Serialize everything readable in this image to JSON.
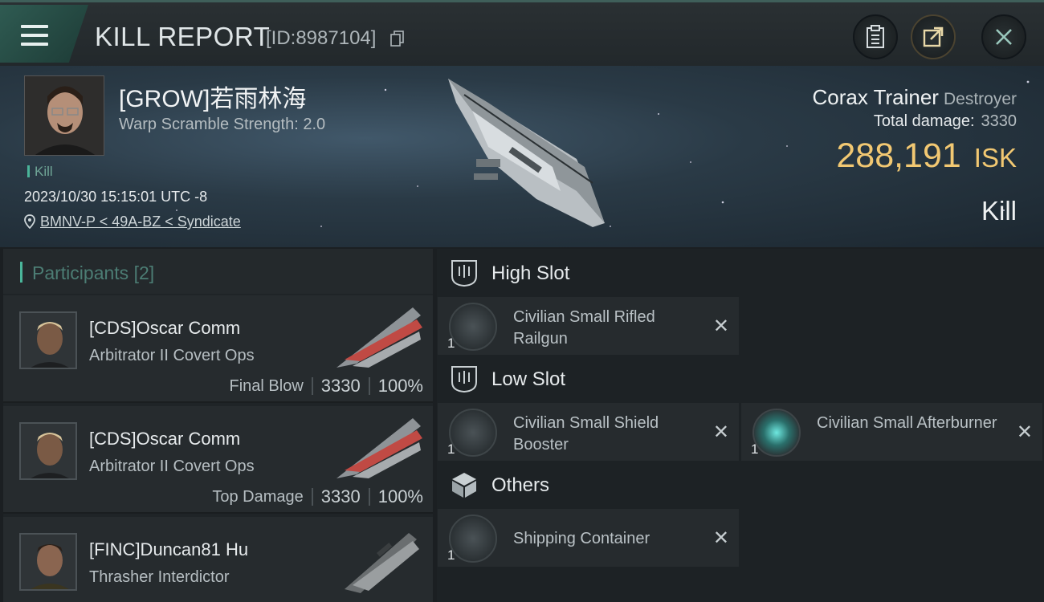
{
  "header": {
    "title": "KILL REPORT",
    "report_id": "[ID:8987104]",
    "buttons": [
      "clipboard-icon",
      "share-icon",
      "close-icon"
    ]
  },
  "victim": {
    "name": "[GROW]若雨林海",
    "warp_scramble": "Warp Scramble Strength: 2.0",
    "tag": "Kill",
    "datetime": "2023/10/30 15:15:01 UTC -8",
    "location": "BMNV-P < 49A-BZ < Syndicate",
    "ship": "Corax Trainer",
    "ship_class": "Destroyer",
    "total_damage_label": "Total damage:",
    "total_damage": "3330",
    "isk_value": "288,191",
    "isk_unit": "ISK",
    "result": "Kill"
  },
  "participants": {
    "label": "Participants",
    "count": "[2]",
    "rows": [
      {
        "name": "[CDS]Oscar Comm",
        "ship": "Arbitrator II Covert Ops",
        "role": "Final Blow",
        "damage": "3330",
        "percent": "100%"
      },
      {
        "name": "[CDS]Oscar Comm",
        "ship": "Arbitrator II Covert Ops",
        "role": "Top Damage",
        "damage": "3330",
        "percent": "100%"
      },
      {
        "name": "[FINC]Duncan81 Hu",
        "ship": "Thrasher Interdictor",
        "role": "",
        "damage": "",
        "percent": ""
      }
    ]
  },
  "fitting": {
    "high_slot": {
      "title": "High Slot",
      "modules": [
        {
          "name": "Civilian Small Rifled Railgun",
          "qty": "1"
        }
      ]
    },
    "low_slot": {
      "title": "Low Slot",
      "modules": [
        {
          "name": "Civilian Small Shield Booster",
          "qty": "1"
        },
        {
          "name": "Civilian Small Afterburner",
          "qty": "1"
        }
      ]
    },
    "others": {
      "title": "Others",
      "modules": [
        {
          "name": "Shipping Container",
          "qty": "1"
        }
      ]
    },
    "close_glyph": "✕"
  },
  "colors": {
    "accent": "#4ab59a",
    "isk": "#f2c872"
  }
}
